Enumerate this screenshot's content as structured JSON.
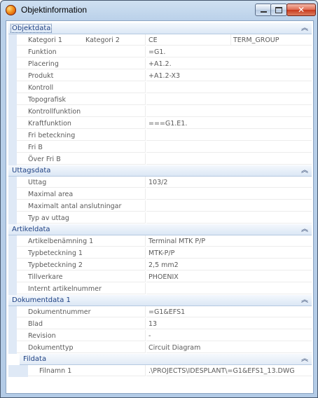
{
  "window": {
    "title": "Objektinformation",
    "controls": {
      "minimize": "minimize-icon",
      "maximize": "maximize-icon",
      "close": "close-icon"
    }
  },
  "sections": {
    "objektdata": {
      "title": "Objektdata",
      "kategori": {
        "label1": "Kategori 1",
        "label2": "Kategori 2",
        "value1": "CE",
        "value2": "TERM_GROUP"
      },
      "rows": [
        {
          "label": "Funktion",
          "value": "=G1."
        },
        {
          "label": "Placering",
          "value": "+A1.2."
        },
        {
          "label": "Produkt",
          "value": "+A1.2-X3"
        },
        {
          "label": "Kontroll",
          "value": ""
        },
        {
          "label": "Topografisk",
          "value": ""
        },
        {
          "label": "Kontrollfunktion",
          "value": ""
        },
        {
          "label": "Kraftfunktion",
          "value": "===G1.E1."
        },
        {
          "label": "Fri beteckning",
          "value": ""
        },
        {
          "label": "Fri B",
          "value": ""
        },
        {
          "label": "Över Fri B",
          "value": ""
        }
      ]
    },
    "uttagsdata": {
      "title": "Uttagsdata",
      "rows": [
        {
          "label": "Uttag",
          "value": "103/2"
        },
        {
          "label": "Maximal area",
          "value": ""
        },
        {
          "label": "Maximalt antal anslutningar",
          "value": ""
        },
        {
          "label": "Typ av uttag",
          "value": ""
        }
      ]
    },
    "artikeldata": {
      "title": "Artikeldata",
      "rows": [
        {
          "label": "Artikelbenämning 1",
          "value": "Terminal MTK P/P"
        },
        {
          "label": "Typbeteckning 1",
          "value": "MTK-P/P"
        },
        {
          "label": "Typbeteckning 2",
          "value": "2,5 mm2"
        },
        {
          "label": "Tillverkare",
          "value": "PHOENIX"
        },
        {
          "label": "Internt artikelnummer",
          "value": ""
        }
      ]
    },
    "dokumentdata": {
      "title": "Dokumentdata 1",
      "rows": [
        {
          "label": "Dokumentnummer",
          "value": "=G1&EFS1"
        },
        {
          "label": "Blad",
          "value": "13"
        },
        {
          "label": "Revision",
          "value": "-"
        },
        {
          "label": "Dokumenttyp",
          "value": "Circuit Diagram"
        }
      ]
    },
    "fildata": {
      "title": "Fildata",
      "rows": [
        {
          "label": "Filnamn 1",
          "value": ".\\PROJECTS\\IDESPLANT\\=G1&EFS1_13.DWG"
        }
      ]
    }
  },
  "collapse_icon": "double-chevron-up-icon",
  "chevron_glyph": "︽"
}
